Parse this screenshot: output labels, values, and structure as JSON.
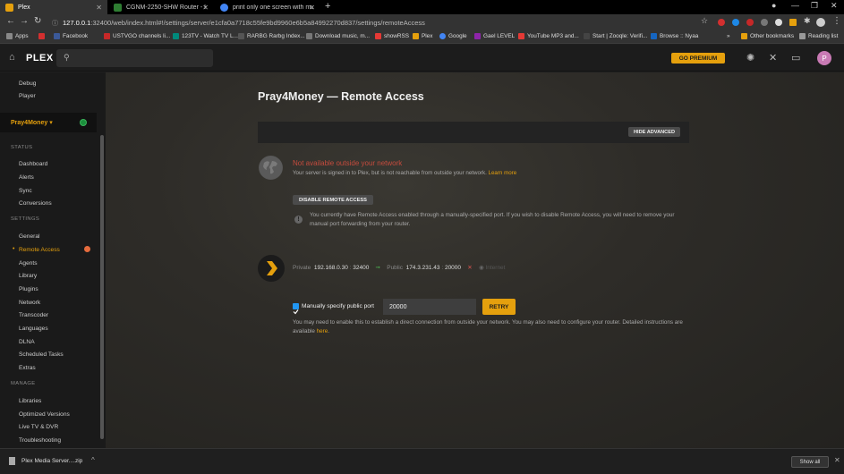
{
  "browser": {
    "tabs": [
      {
        "title": "Plex",
        "color": "#e5a00d",
        "active": true
      },
      {
        "title": "CGNM-2250-SHW Router - Hitro",
        "color": "#2e7d32",
        "active": false
      },
      {
        "title": "print only one screen with multi",
        "color": "#4285f4",
        "active": false
      }
    ],
    "new_tab": "+",
    "url_host": "127.0.0.1",
    "url_rest": ":32400/web/index.html#!/settings/server/e1cfa0a7718c55fe9bd9960e6b5a84992270d837/settings/remoteAccess",
    "bookmarks": [
      {
        "label": "Apps",
        "color": "#888"
      },
      {
        "label": "",
        "color": "#d32f2f"
      },
      {
        "label": "Facebook",
        "color": "#3b5998"
      },
      {
        "label": "USTVGO channels li...",
        "color": "#c62828"
      },
      {
        "label": "123TV - Watch TV L...",
        "color": "#00897b"
      },
      {
        "label": "RARBG Rarbg Index...",
        "color": "#555"
      },
      {
        "label": "Download music, m...",
        "color": "#777"
      },
      {
        "label": "showRSS",
        "color": "#e53935"
      },
      {
        "label": "Plex",
        "color": "#e5a00d"
      },
      {
        "label": "Google",
        "color": "#4285f4"
      },
      {
        "label": "Gael LEVEL",
        "color": "#8e24aa"
      },
      {
        "label": "YouTube MP3 and...",
        "color": "#e53935"
      },
      {
        "label": "Start | Zooqle: Verifi...",
        "color": "#444"
      },
      {
        "label": "Browse :: Nyaa",
        "color": "#1565c0"
      }
    ],
    "other_bookmarks": "Other bookmarks",
    "reading_list": "Reading list"
  },
  "plex": {
    "logo": "PLEX",
    "go_premium": "GO PREMIUM",
    "avatar_letter": "P"
  },
  "sidebar": {
    "top_items": [
      "Debug",
      "Player"
    ],
    "server_name": "Pray4Money",
    "sections": [
      {
        "title": "STATUS",
        "items": [
          "Dashboard",
          "Alerts",
          "Sync",
          "Conversions"
        ]
      },
      {
        "title": "SETTINGS",
        "items": [
          "General",
          "Remote Access",
          "Agents",
          "Library",
          "Plugins",
          "Network",
          "Transcoder",
          "Languages",
          "DLNA",
          "Scheduled Tasks",
          "Extras"
        ]
      },
      {
        "title": "MANAGE",
        "items": [
          "Libraries",
          "Optimized Versions",
          "Live TV & DVR",
          "Troubleshooting"
        ]
      }
    ],
    "active_item": "Remote Access"
  },
  "main": {
    "title": "Pray4Money — Remote Access",
    "hide_advanced": "HIDE ADVANCED",
    "status_title": "Not available outside your network",
    "status_desc": "Your server is signed in to Plex, but is not reachable from outside your network.",
    "learn_more": "Learn more",
    "disable_button": "DISABLE REMOTE ACCESS",
    "info_text": "You currently have Remote Access enabled through a manually-specified port. If you wish to disable Remote Access, you will need to remove your manual port forwarding from your router.",
    "private_label": "Private",
    "private_ip": "192.168.0.30",
    "private_port": "32400",
    "public_label": "Public",
    "public_ip": "174.3.231.43",
    "public_port": "20000",
    "internet_label": "Internet",
    "manual_port_label": "Manually specify public port",
    "manual_port_value": "20000",
    "retry": "RETRY",
    "port_desc": "You may need to enable this to establish a direct connection from outside your network. You may also need to configure your router. Detailed instructions are available",
    "here": "here"
  },
  "downloads": {
    "file": "Plex Media Server....zip",
    "show_all": "Show all"
  }
}
